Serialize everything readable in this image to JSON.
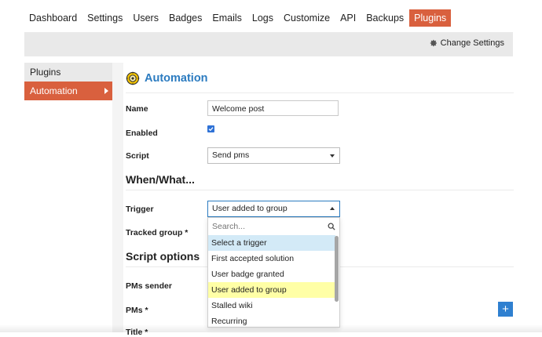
{
  "topnav": {
    "tabs": [
      {
        "label": "Dashboard"
      },
      {
        "label": "Settings"
      },
      {
        "label": "Users"
      },
      {
        "label": "Badges"
      },
      {
        "label": "Emails"
      },
      {
        "label": "Logs"
      },
      {
        "label": "Customize"
      },
      {
        "label": "API"
      },
      {
        "label": "Backups"
      },
      {
        "label": "Plugins",
        "active": true
      }
    ]
  },
  "adminbar": {
    "change_settings_label": "Change Settings",
    "icon": "gear-icon"
  },
  "sidenav": {
    "items": [
      {
        "label": "Plugins"
      },
      {
        "label": "Automation",
        "active": true
      }
    ]
  },
  "automation": {
    "title": "Automation",
    "title_icon": "automation-gear-icon",
    "accent_color": "#2b7bc0",
    "fields": {
      "name_label": "Name",
      "name_value": "Welcome post",
      "enabled_label": "Enabled",
      "enabled_checked": true,
      "script_label": "Script",
      "script_value": "Send pms"
    },
    "when_what_title": "When/What...",
    "trigger_label": "Trigger",
    "trigger_value": "User added to group",
    "tracked_group_label": "Tracked group *",
    "script_options_title": "Script options",
    "pms_sender_label": "PMs sender",
    "pms_label": "PMs *",
    "title_field_label": "Title *"
  },
  "trigger_dropdown": {
    "search_placeholder": "Search...",
    "options": [
      {
        "label": "Select a trigger",
        "state": "hover"
      },
      {
        "label": "First accepted solution"
      },
      {
        "label": "User badge granted"
      },
      {
        "label": "User added to group",
        "state": "selected"
      },
      {
        "label": "Stalled wiki"
      },
      {
        "label": "Recurring"
      }
    ]
  },
  "add_button_label": "+",
  "colors": {
    "active_tab": "#d9603e",
    "highlight_hover": "#d3eaf7",
    "highlight_selected": "#ffffa6",
    "button_blue": "#2f80d0"
  }
}
